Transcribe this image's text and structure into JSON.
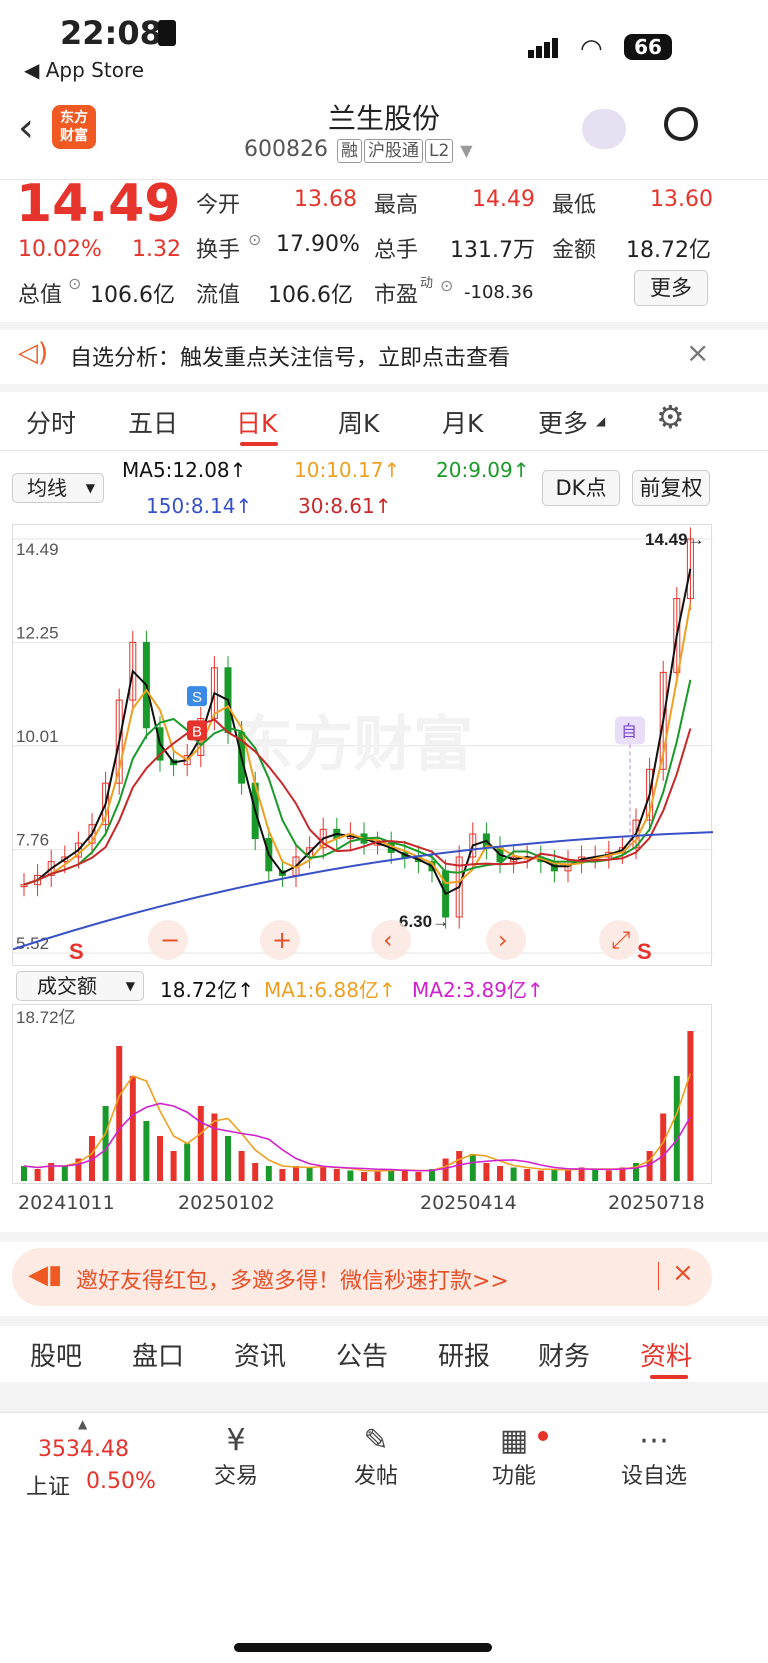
{
  "status": {
    "time": "22:08",
    "back_app": "App Store",
    "battery": "66"
  },
  "header": {
    "logo_line1": "东方",
    "logo_line2": "财富",
    "title": "兰生股份",
    "code": "600826",
    "tag1": "融",
    "tag2": "沪股通",
    "tag3": "L2"
  },
  "quote": {
    "price": "14.49",
    "pct": "10.02%",
    "change": "1.32",
    "open_label": "今开",
    "open": "13.68",
    "high_label": "最高",
    "high": "14.49",
    "low_label": "最低",
    "low": "13.60",
    "turnover_label": "换手",
    "turnover": "17.90%",
    "volume_label": "总手",
    "volume": "131.7万",
    "amount_label": "金额",
    "amount": "18.72亿",
    "mktcap_label": "总值",
    "mktcap": "106.6亿",
    "float_label": "流值",
    "float": "106.6亿",
    "pe_label": "市盈",
    "pe_sup": "动",
    "pe": "-108.36",
    "more": "更多"
  },
  "alert": {
    "text": "自选分析：触发重点关注信号，立即点击查看",
    "close": "×"
  },
  "tabs": [
    "分时",
    "五日",
    "日K",
    "周K",
    "月K",
    "更多"
  ],
  "ma_bar": {
    "select": "均线",
    "ma5": "MA5:12.08↑",
    "ma10": "10:10.17↑",
    "ma20": "20:9.09↑",
    "ma150": "150:8.14↑",
    "ma30": "30:8.61↑",
    "dk": "DK点",
    "fq": "前复权"
  },
  "chart": {
    "price_ticks": [
      "14.49",
      "12.25",
      "10.01",
      "7.76",
      "5.52"
    ],
    "last_label": "14.49→",
    "low_label": "6.30→",
    "self_tag": "自",
    "watermark": "东方财富",
    "sig_s": "S",
    "sig_b": "B",
    "sig_s2": "S",
    "colors": {
      "ma5": "#111111",
      "ma10": "#f0a020",
      "ma20": "#1a9a2a",
      "ma30": "#c8282a",
      "ma150": "#3850c8",
      "up": "#e6332b",
      "down": "#1a9a2a"
    }
  },
  "vol_bar": {
    "select": "成交额",
    "value": "18.72亿↑",
    "ma1": "MA1:6.88亿↑",
    "ma2": "MA2:3.89亿↑",
    "top_tick": "18.72亿"
  },
  "dates": [
    "20241011",
    "20250102",
    "20250414",
    "20250718"
  ],
  "promo": {
    "text": "邀好友得红包，多邀多得！微信秒速打款>>",
    "close": "×"
  },
  "sub_tabs": [
    "股吧",
    "盘口",
    "资讯",
    "公告",
    "研报",
    "财务",
    "资料"
  ],
  "bottom": {
    "index_value": "3534.48",
    "index_name": "上证",
    "index_pct": "0.50%",
    "trade": "交易",
    "post": "发帖",
    "func": "功能",
    "watch": "设自选"
  },
  "chart_data": {
    "type": "candlestick",
    "title": "",
    "ylim": [
      5.52,
      14.49
    ],
    "x_ticks": [
      "20241011",
      "20250102",
      "20250414",
      "20250718"
    ],
    "series": [
      {
        "name": "MA5",
        "values": [
          12.08
        ]
      },
      {
        "name": "MA10",
        "values": [
          10.17
        ]
      },
      {
        "name": "MA20",
        "values": [
          9.09
        ]
      },
      {
        "name": "MA30",
        "values": [
          8.61
        ]
      },
      {
        "name": "MA150",
        "values": [
          8.14
        ]
      }
    ],
    "marked_high": 14.49,
    "marked_low": 6.3
  }
}
